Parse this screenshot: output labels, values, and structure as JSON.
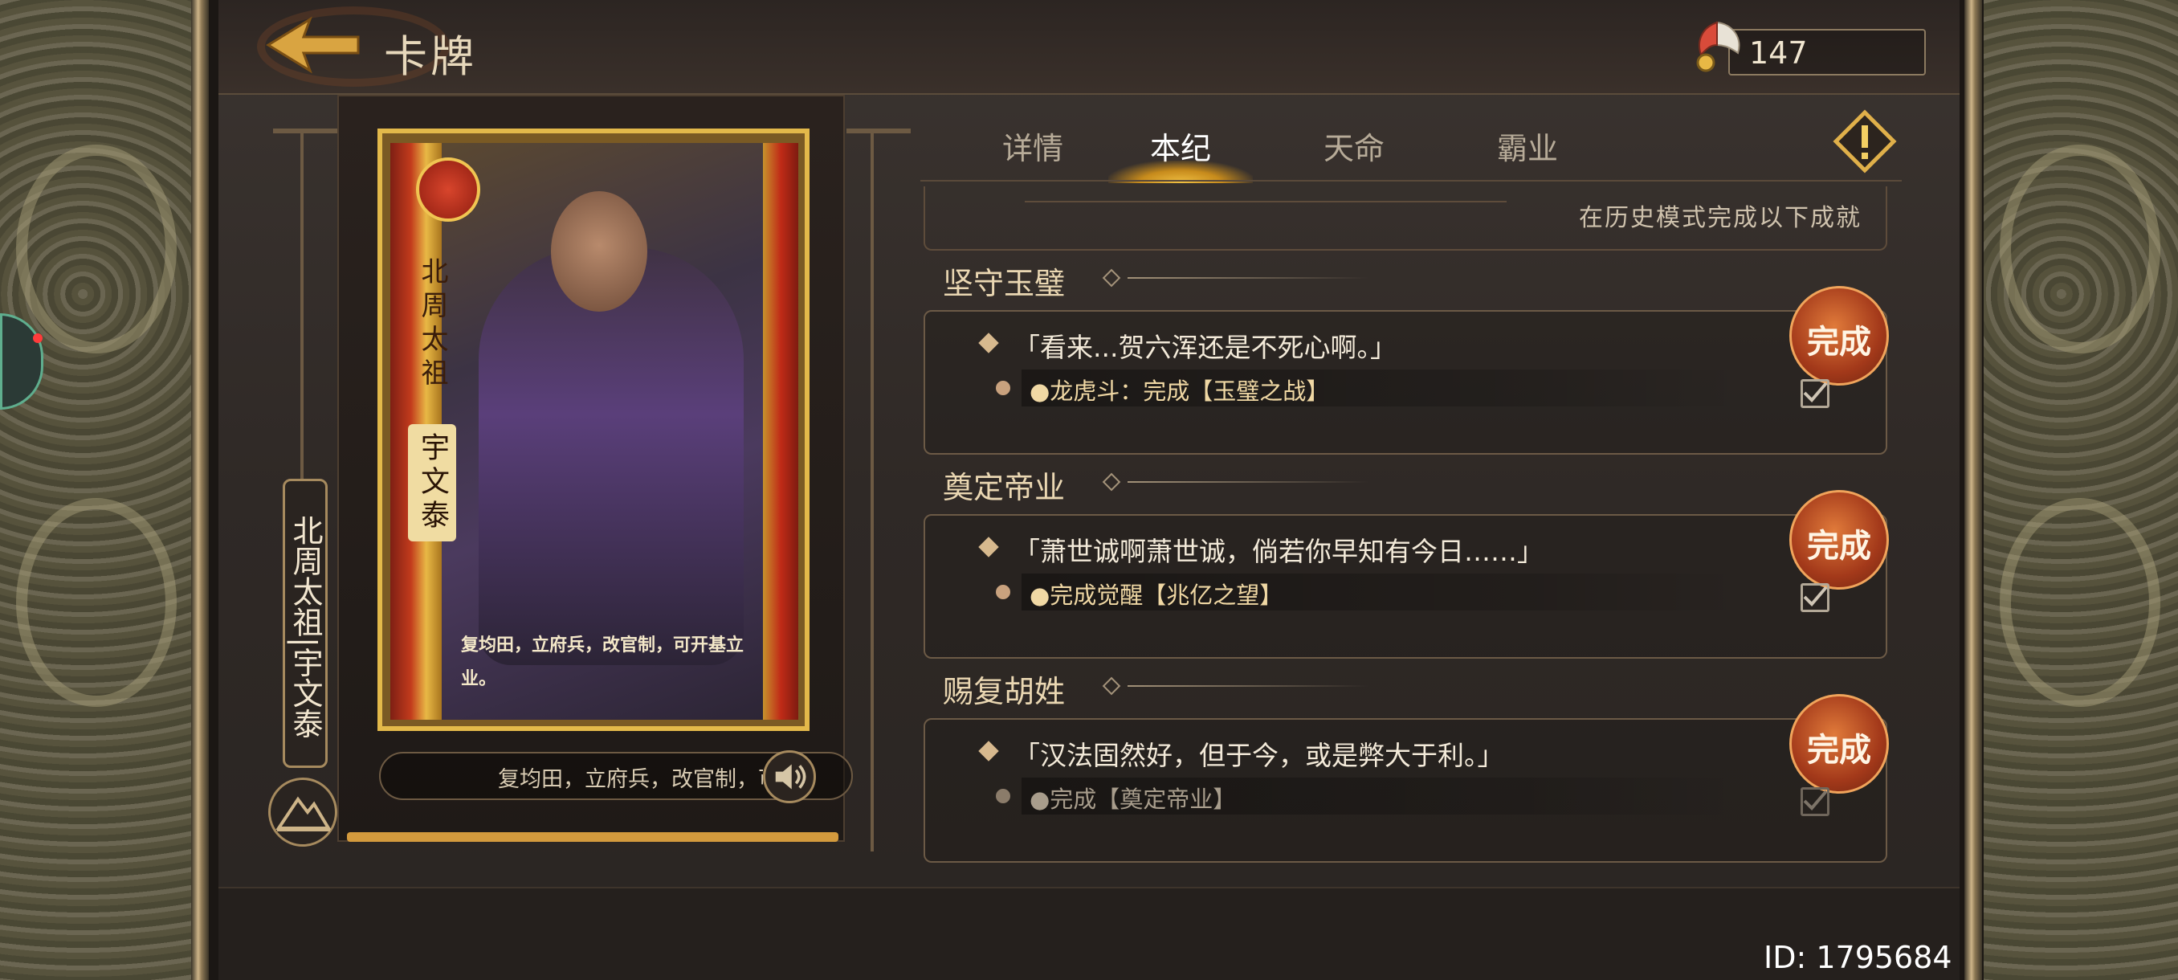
{
  "header": {
    "title": "卡牌",
    "back_icon": "arrow-left-icon",
    "currency_icon": "feather-token-icon",
    "currency_value": "147"
  },
  "card": {
    "portrait_title": "北周太祖",
    "portrait_name": "宇文泰",
    "portrait_quote": "复均田，立府兵，改官制，可开基立业。",
    "side_name": "北周太祖|宇文泰",
    "subtitle": "复均田，立府兵，改官制，可开基立业。",
    "speaker_icon": "speaker-icon",
    "mountain_icon": "mountain-icon"
  },
  "tabs": [
    {
      "label": "详情",
      "active": false
    },
    {
      "label": "本纪",
      "active": true
    },
    {
      "label": "天命",
      "active": false
    },
    {
      "label": "霸业",
      "active": false
    }
  ],
  "info_icon": "exclamation-diamond-icon",
  "hint": "在历史模式完成以下成就",
  "achievements": [
    {
      "title": "坚守玉璧",
      "quote": "「看来...贺六浑还是不死心啊。」",
      "requirement": "●龙虎斗：完成【玉璧之战】",
      "stamp": "完成",
      "checked": true,
      "dim": false
    },
    {
      "title": "奠定帝业",
      "quote": "「萧世诚啊萧世诚，倘若你早知有今日……」",
      "requirement": "●完成觉醒【兆亿之望】",
      "stamp": "完成",
      "checked": true,
      "dim": false
    },
    {
      "title": "赐复胡姓",
      "quote": "「汉法固然好，但于今，或是弊大于利。」",
      "requirement": "●完成【奠定帝业】",
      "stamp": "完成",
      "checked": true,
      "dim": true
    }
  ],
  "user_id": "ID: 1795684",
  "colors": {
    "accent_gold": "#e3b94a",
    "tab_active": "#ffffff",
    "stamp": "#a3391a"
  }
}
